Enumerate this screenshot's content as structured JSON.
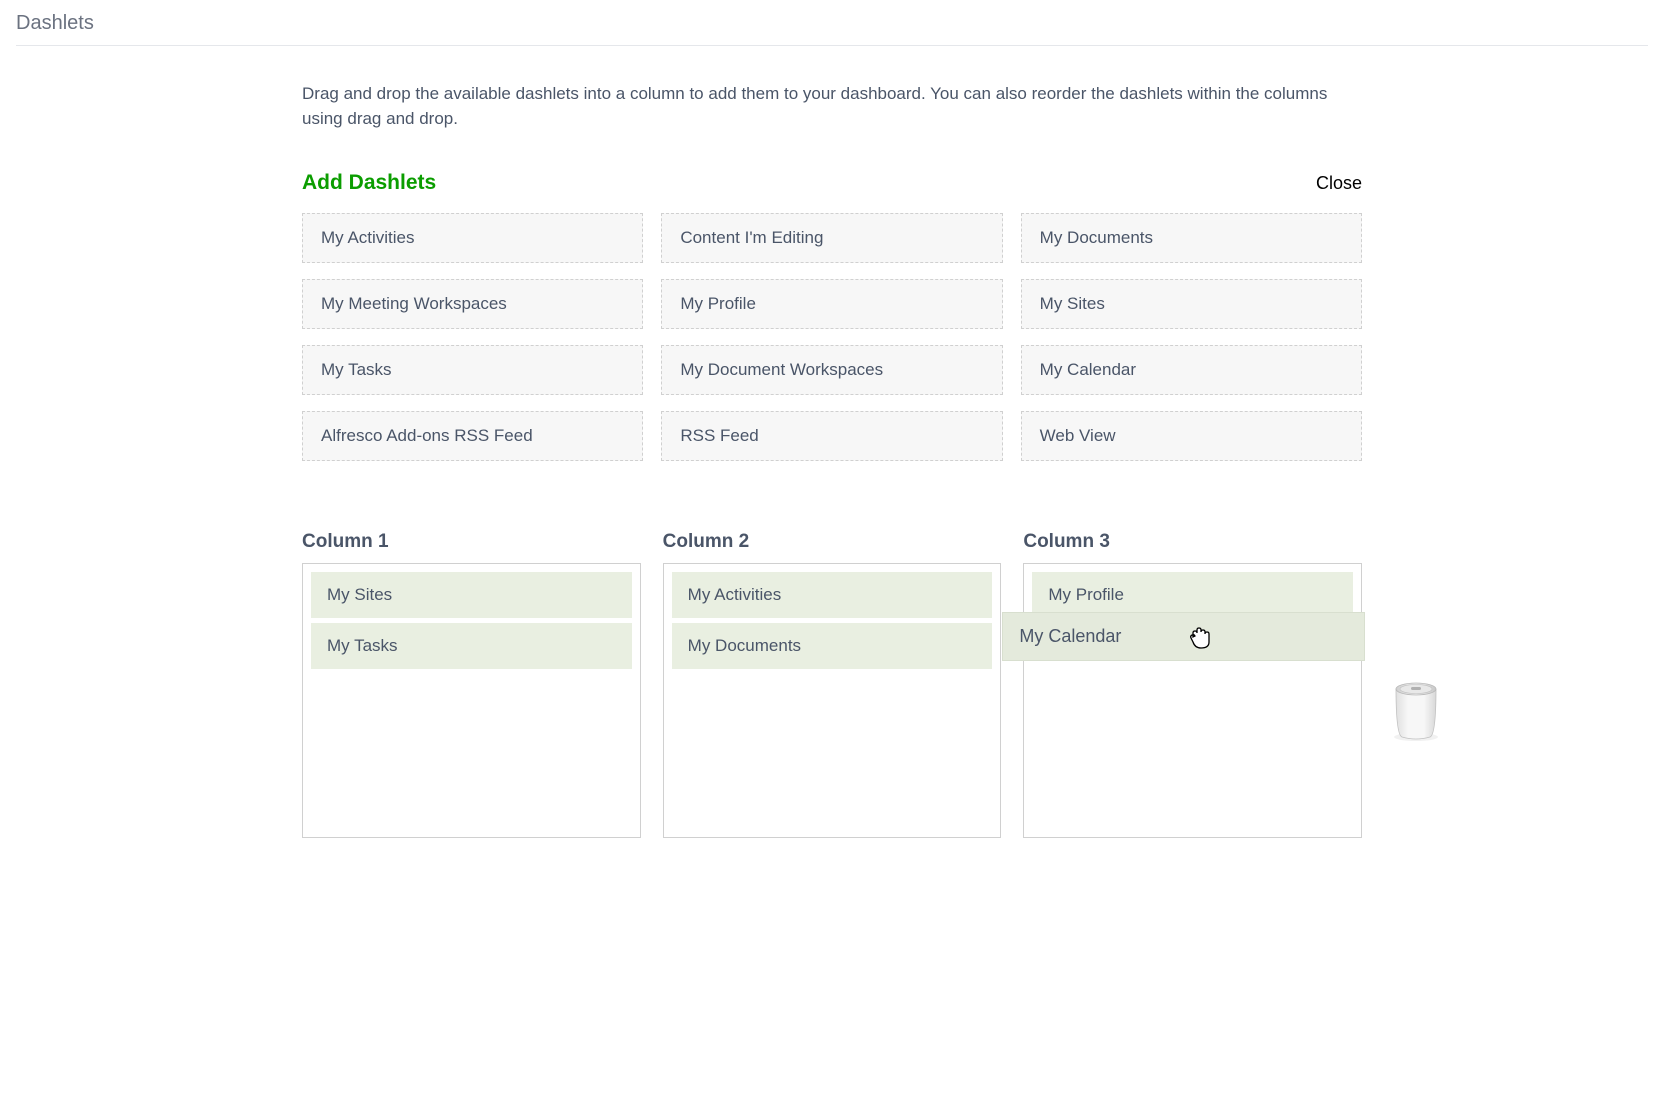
{
  "page": {
    "title": "Dashlets",
    "description": "Drag and drop the available dashlets into a column to add them to your dashboard. You can also reorder the dashlets within the columns using drag and drop."
  },
  "addSection": {
    "title": "Add Dashlets",
    "closeLabel": "Close"
  },
  "availableDashlets": [
    "My Activities",
    "Content I'm Editing",
    "My Documents",
    "My Meeting Workspaces",
    "My Profile",
    "My Sites",
    "My Tasks",
    "My Document Workspaces",
    "My Calendar",
    "Alfresco Add-ons RSS Feed",
    "RSS Feed",
    "Web View"
  ],
  "columns": [
    {
      "title": "Column 1",
      "items": [
        "My Sites",
        "My Tasks"
      ]
    },
    {
      "title": "Column 2",
      "items": [
        "My Activities",
        "My Documents"
      ]
    },
    {
      "title": "Column 3",
      "items": [
        "My Profile"
      ],
      "dragging": "My Calendar"
    }
  ]
}
